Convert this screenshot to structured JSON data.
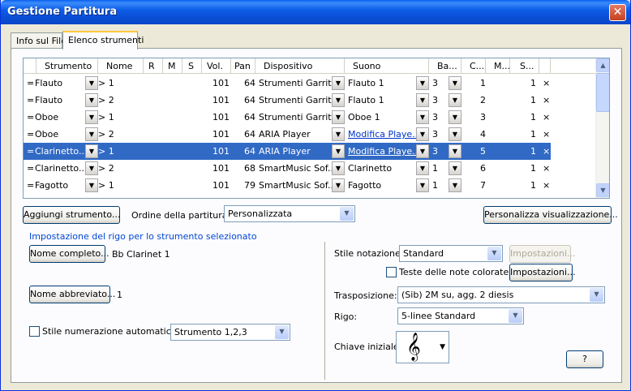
{
  "window": {
    "title": "Gestione Partitura",
    "close_glyph": "✕"
  },
  "tabs": [
    {
      "label": "Info sul File",
      "active": false
    },
    {
      "label": "Elenco strumenti",
      "active": true
    }
  ],
  "grid": {
    "columns": [
      "Strumento",
      "Nome",
      "R",
      "M",
      "S",
      "Vol.",
      "Pan",
      "Dispositivo",
      "Suono",
      "Ba...",
      "C...",
      "M...",
      "S..."
    ],
    "rows": [
      {
        "marker": "=",
        "instrument": "Flauto",
        "name": "> 1",
        "vol": "101",
        "pan": "64",
        "device": "Strumenti Garrit...",
        "sound": "Flauto 1",
        "sound_is_link": false,
        "bank": "3",
        "channel": "1",
        "s": "1",
        "x": "×",
        "selected": false
      },
      {
        "marker": "=",
        "instrument": "Flauto",
        "name": "> 2",
        "vol": "101",
        "pan": "64",
        "device": "Strumenti Garrit...",
        "sound": "Flauto 1",
        "sound_is_link": false,
        "bank": "3",
        "channel": "2",
        "s": "1",
        "x": "×",
        "selected": false
      },
      {
        "marker": "=",
        "instrument": "Oboe",
        "name": "> 1",
        "vol": "101",
        "pan": "64",
        "device": "Strumenti Garrit...",
        "sound": "Oboe 1",
        "sound_is_link": false,
        "bank": "3",
        "channel": "3",
        "s": "1",
        "x": "×",
        "selected": false
      },
      {
        "marker": "=",
        "instrument": "Oboe",
        "name": "> 2",
        "vol": "101",
        "pan": "64",
        "device": "ARIA Player",
        "sound": "Modifica Playe...",
        "sound_is_link": true,
        "bank": "3",
        "channel": "4",
        "s": "1",
        "x": "×",
        "selected": false
      },
      {
        "marker": "=",
        "instrument": "Clarinetto...",
        "name": "> 1",
        "vol": "101",
        "pan": "64",
        "device": "ARIA Player",
        "sound": "Modifica Playe...",
        "sound_is_link": true,
        "bank": "3",
        "channel": "5",
        "s": "1",
        "x": "×",
        "selected": true
      },
      {
        "marker": "=",
        "instrument": "Clarinetto...",
        "name": "> 2",
        "vol": "101",
        "pan": "68",
        "device": "SmartMusic Sof...",
        "sound": "Clarinetto",
        "sound_is_link": false,
        "bank": "1",
        "channel": "6",
        "s": "1",
        "x": "×",
        "selected": false
      },
      {
        "marker": "=",
        "instrument": "Fagotto",
        "name": "> 1",
        "vol": "101",
        "pan": "79",
        "device": "SmartMusic Sof...",
        "sound": "Fagotto",
        "sound_is_link": false,
        "bank": "1",
        "channel": "7",
        "s": "1",
        "x": "×",
        "selected": false
      }
    ]
  },
  "toolbar": {
    "add_instrument": "Aggiungi strumento...",
    "order_label": "Ordine della partitura:",
    "order_value": "Personalizzata",
    "customize_view": "Personalizza visualizzazione..."
  },
  "staff_settings": {
    "group_title": "Impostazione del rigo per lo strumento selezionato",
    "full_name_button": "Nome completo...",
    "full_name_value": "Bb Clarinet 1",
    "short_name_button": "Nome abbreviato...",
    "short_name_value": "1",
    "auto_numbering_label": "Stile numerazione automatica:",
    "auto_numbering_checked": false,
    "auto_numbering_value": "Strumento 1,2,3"
  },
  "notation": {
    "style_label": "Stile notazione:",
    "style_value": "Standard",
    "settings_disabled": "Impostazioni...",
    "colored_heads_label": "Teste delle note colorate",
    "colored_heads_checked": false,
    "settings_button": "Impostazioni...",
    "transposition_label": "Trasposizione:",
    "transposition_value": "(Sib) 2M su, agg. 2 diesis",
    "staff_label": "Rigo:",
    "staff_value": "5-linee Standard",
    "clef_label": "Chiave iniziale:",
    "clef_glyph": "𝄞",
    "help_button": "?"
  },
  "icons": {
    "dropdown": "chevron-down-icon",
    "scroll_up": "scroll-up-icon",
    "scroll_down": "scroll-down-icon",
    "remove": "remove-icon",
    "clef": "treble-clef-icon"
  },
  "colors": {
    "title_bar": "#0A4FD6",
    "selection": "#316AC5",
    "group_title": "#0046D5",
    "link": "#0033CC"
  }
}
